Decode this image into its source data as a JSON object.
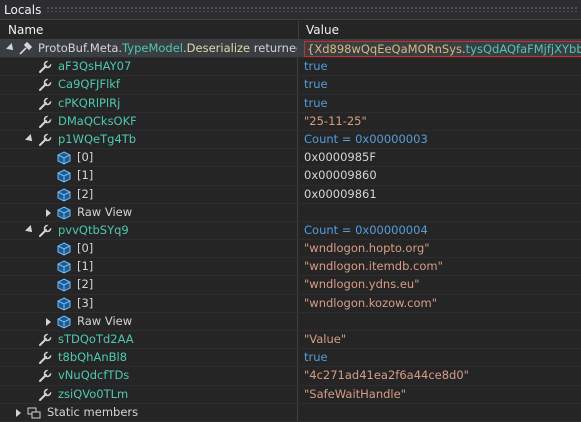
{
  "window": {
    "title": "Locals"
  },
  "columns": {
    "name": "Name",
    "value": "Value"
  },
  "root": {
    "ns": "ProtoBuf.Meta.",
    "cls": "TypeModel",
    "dot": ".",
    "meth": "Deserialize",
    "suffix": " returned",
    "value_brace_open": "{",
    "value_obj": "Xd898wQqEeQaMORnSys",
    "value_dot": ".",
    "value_cls": "tysQdAQfaFMjfjXYbbO",
    "value_brace_close": "}"
  },
  "rows": [
    {
      "name": "aF3QsHAY07",
      "value": "true",
      "kind": "bool"
    },
    {
      "name": "Ca9QFJFlkf",
      "value": "true",
      "kind": "bool"
    },
    {
      "name": "cPKQRlPlRj",
      "value": "true",
      "kind": "bool"
    },
    {
      "name": "DMaQCksOKF",
      "value": "\"25-11-25\"",
      "kind": "str"
    },
    {
      "name": "p1WQeTg4Tb",
      "value": "Count = 0x00000003",
      "kind": "count"
    },
    {
      "name": "[0]",
      "value": "0x0000985F",
      "kind": "num"
    },
    {
      "name": "[1]",
      "value": "0x00009860",
      "kind": "num"
    },
    {
      "name": "[2]",
      "value": "0x00009861",
      "kind": "num"
    },
    {
      "name": "Raw View",
      "value": "",
      "kind": "raw"
    },
    {
      "name": "pvvQtbSYq9",
      "value": "Count = 0x00000004",
      "kind": "count"
    },
    {
      "name": "[0]",
      "value": "\"wndlogon.hopto.org\"",
      "kind": "str"
    },
    {
      "name": "[1]",
      "value": "\"wndlogon.itemdb.com\"",
      "kind": "str"
    },
    {
      "name": "[2]",
      "value": "\"wndlogon.ydns.eu\"",
      "kind": "str"
    },
    {
      "name": "[3]",
      "value": "\"wndlogon.kozow.com\"",
      "kind": "str"
    },
    {
      "name": "Raw View",
      "value": "",
      "kind": "raw"
    },
    {
      "name": "sTDQoTd2AA",
      "value": "\"Value\"",
      "kind": "str"
    },
    {
      "name": "t8bQhAnBl8",
      "value": "true",
      "kind": "bool"
    },
    {
      "name": "vNuQdcfTDs",
      "value": "\"4c271ad41ea2f6a44ce8d0\"",
      "kind": "str"
    },
    {
      "name": "zsiQVo0TLm",
      "value": "\"SafeWaitHandle\"",
      "kind": "str"
    },
    {
      "name": "Static members",
      "value": "",
      "kind": "static"
    }
  ],
  "icons": {
    "property": "wrench-icon",
    "element": "cube-icon",
    "raw": "raw-view-icon",
    "static": "static-members-icon"
  },
  "colors": {
    "background": "#252526",
    "property_name": "#4ec9b0",
    "keyword_value": "#569cd6",
    "string_value": "#d69d85",
    "highlight_box": "#c72e2e"
  }
}
